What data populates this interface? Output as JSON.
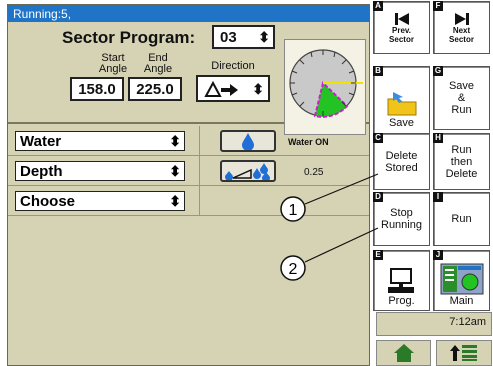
{
  "status_title": "Running:5,",
  "sector": {
    "label": "Sector Program:",
    "number": "03",
    "start_label": "Start",
    "start_label2": "Angle",
    "end_label": "End",
    "end_label2": "Angle",
    "direction_label": "Direction",
    "start_value": "158.0",
    "end_value": "225.0"
  },
  "rows": [
    {
      "select": "Water",
      "status": "Water ON"
    },
    {
      "select": "Depth",
      "status": "0.25"
    },
    {
      "select": "Choose",
      "status": ""
    }
  ],
  "keys": {
    "A": {
      "letter": "A",
      "l1": "Prev.",
      "l2": "Sector"
    },
    "F": {
      "letter": "F",
      "l1": "Next",
      "l2": "Sector"
    },
    "B": {
      "letter": "B",
      "label": "Save"
    },
    "G": {
      "letter": "G",
      "l1": "Save",
      "l2": "&",
      "l3": "Run"
    },
    "C": {
      "letter": "C",
      "l1": "Delete",
      "l2": "Stored"
    },
    "H": {
      "letter": "H",
      "l1": "Run",
      "l2": "then",
      "l3": "Delete"
    },
    "D": {
      "letter": "D",
      "l1": "Stop",
      "l2": "Running"
    },
    "I": {
      "letter": "I",
      "l1": "Run"
    },
    "E": {
      "letter": "E",
      "label": "Prog."
    },
    "J": {
      "letter": "J",
      "label": "Main"
    }
  },
  "clock": "7:12am",
  "callouts": [
    "1",
    "2"
  ],
  "colors": {
    "accent": "#1f74c8",
    "panel": "#d6d3b4",
    "sector_fill": "#22c322",
    "sector_edge": "#d01bd0"
  },
  "icons": [
    "prev-track-icon",
    "next-track-icon",
    "save-folder-icon",
    "water-drop-icon",
    "depth-drops-icon",
    "computer-icon",
    "main-screen-icon",
    "home-icon",
    "up-list-icon",
    "direction-arrow-icon"
  ]
}
